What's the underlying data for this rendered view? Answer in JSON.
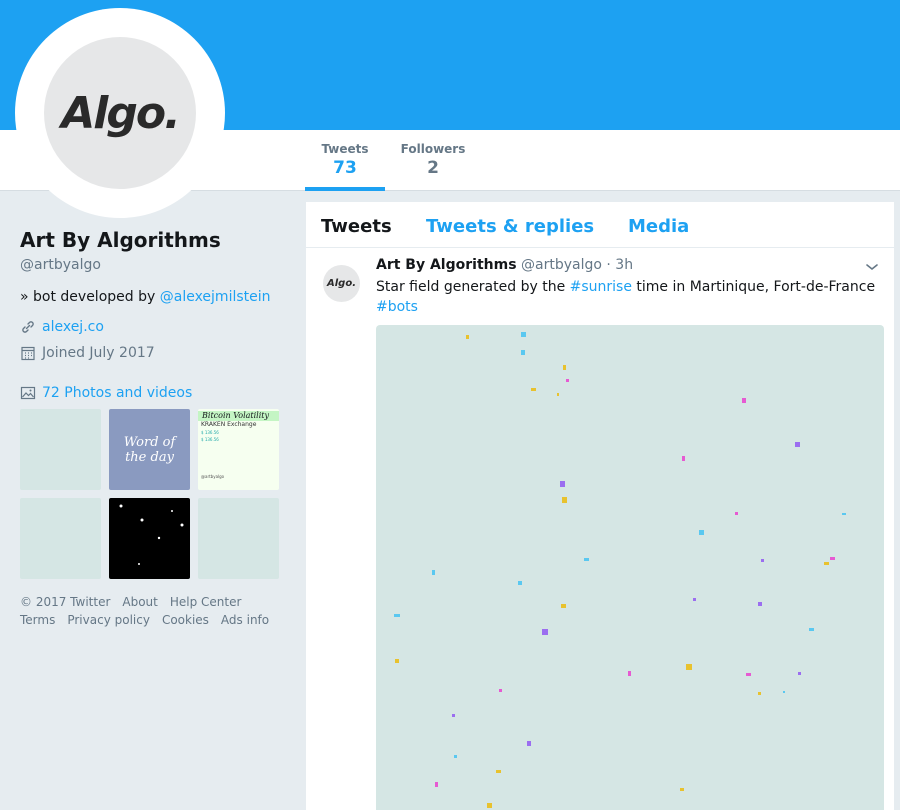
{
  "profile": {
    "avatar_text": "Algo.",
    "name": "Art By Algorithms",
    "handle": "@artbyalgo",
    "bio_prefix": "» bot developed by ",
    "bio_mention": "@alexejmilstein",
    "website": "alexej.co",
    "joined": "Joined July 2017",
    "photos_label": "72 Photos and videos"
  },
  "stats": {
    "tweets_label": "Tweets",
    "tweets_count": "73",
    "followers_label": "Followers",
    "followers_count": "2"
  },
  "thumbs": {
    "word_line1": "Word of",
    "word_line2": "the day",
    "kraken_title": "Bitcoin Volatility",
    "kraken_line": "KRAKEN Exchange",
    "kraken_val1": "$ 136.56",
    "kraken_val2": "$ 136.56",
    "kraken_footer": "@artbyalgo"
  },
  "footer": {
    "items_row1": [
      "© 2017 Twitter",
      "About",
      "Help Center"
    ],
    "items_row2": [
      "Terms",
      "Privacy policy",
      "Cookies",
      "Ads info"
    ]
  },
  "timeline": {
    "tabs": [
      "Tweets",
      "Tweets & replies",
      "Media"
    ]
  },
  "tweet": {
    "author_name": "Art By Algorithms",
    "author_handle": "@artbyalgo",
    "sep": "·",
    "time": "3h",
    "text_prefix": "Star field generated by the ",
    "hashtag1": "#sunrise",
    "text_mid": " time in Martinique, Fort-de-France",
    "hashtag2": "#bots",
    "avatar_text": "Algo."
  },
  "colors": {
    "brand": "#1da1f2",
    "star_yellow": "#e8c22e",
    "star_blue": "#5ac8f0",
    "star_purple": "#9b6ef0",
    "star_pink": "#e65ad2"
  },
  "icons": {
    "website": "link-icon",
    "joined": "calendar-icon",
    "photos": "image-icon",
    "caret": "chevron-down-icon"
  }
}
